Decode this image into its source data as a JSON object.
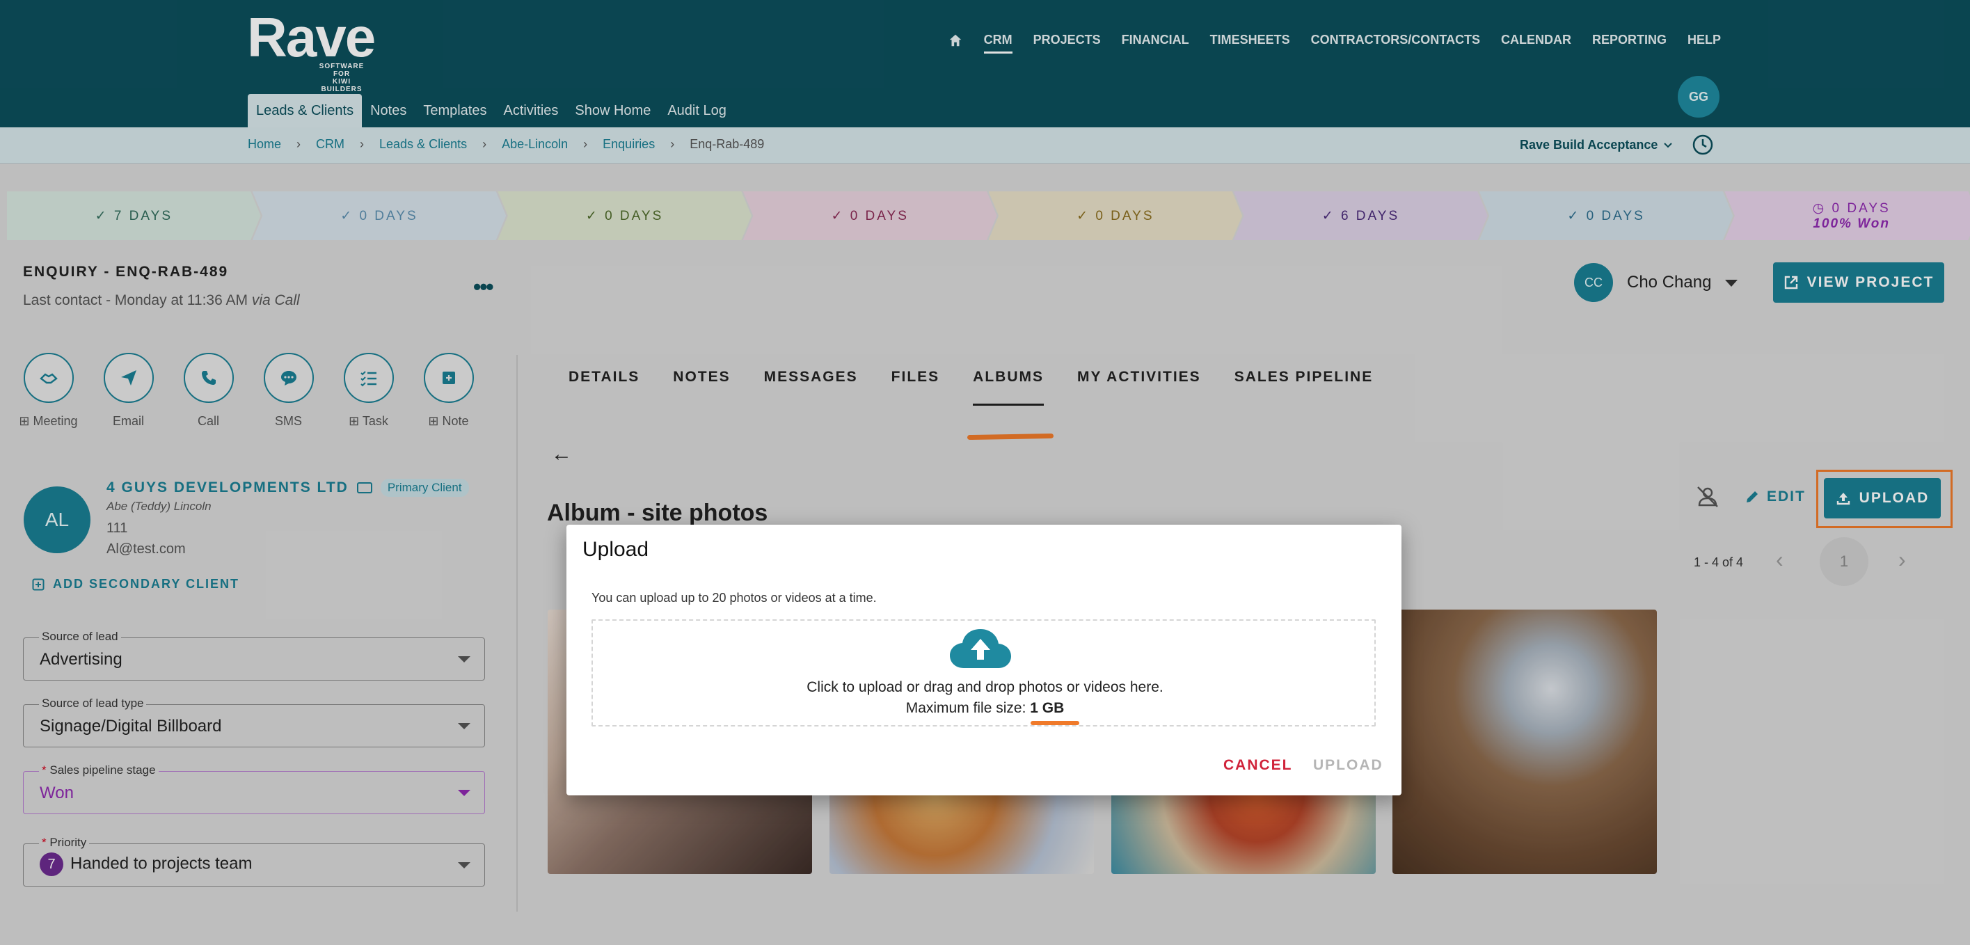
{
  "header": {
    "logo_text": "Rave",
    "logo_tagline_1": "SOFTWARE FOR",
    "logo_tagline_2": "KIWI BUILDERS",
    "nav": [
      "CRM",
      "PROJECTS",
      "FINANCIAL",
      "TIMESHEETS",
      "CONTRACTORS/CONTACTS",
      "CALENDAR",
      "REPORTING",
      "HELP"
    ],
    "user_initials": "GG",
    "subnav": [
      "Leads & Clients",
      "Notes",
      "Templates",
      "Activities",
      "Show Home",
      "Audit Log"
    ]
  },
  "breadcrumb": {
    "items": [
      "Home",
      "CRM",
      "Leads & Clients",
      "Abe-Lincoln",
      "Enquiries"
    ],
    "current": "Enq-Rab-489",
    "separator": "›",
    "environment": "Rave Build Acceptance"
  },
  "stages": [
    {
      "label": "7 DAYS",
      "bg": "#d7e6df",
      "fg": "#2f6b5a",
      "prefix": "✓"
    },
    {
      "label": "0 DAYS",
      "bg": "#d6e2ea",
      "fg": "#5c8fb0",
      "prefix": "✓"
    },
    {
      "label": "0 DAYS",
      "bg": "#dde5d0",
      "fg": "#4e6a2a",
      "prefix": "✓"
    },
    {
      "label": "0 DAYS",
      "bg": "#e9d3de",
      "fg": "#8b2a55",
      "prefix": "✓"
    },
    {
      "label": "0 DAYS",
      "bg": "#e8e0c8",
      "fg": "#8a6d1d",
      "prefix": "✓"
    },
    {
      "label": "6 DAYS",
      "bg": "#ddd2e6",
      "fg": "#4b2a7a",
      "prefix": "✓"
    },
    {
      "label": "0 DAYS",
      "bg": "#d2e0e8",
      "fg": "#2f6f8f",
      "prefix": "✓"
    },
    {
      "label": "0 DAYS",
      "bg": "#e6d2e9",
      "fg": "#8f2ab0",
      "prefix": "◷",
      "sub": "100% Won"
    }
  ],
  "enquiry": {
    "title": "ENQUIRY - ENQ-RAB-489",
    "last_contact": "Last contact - Monday at 11:36 AM",
    "via": "via Call"
  },
  "quick_actions": [
    {
      "label": "Meeting",
      "prefix": "⊞"
    },
    {
      "label": "Email",
      "prefix": ""
    },
    {
      "label": "Call",
      "prefix": ""
    },
    {
      "label": "SMS",
      "prefix": ""
    },
    {
      "label": "Task",
      "prefix": "⊞"
    },
    {
      "label": "Note",
      "prefix": "⊞"
    }
  ],
  "client": {
    "initials": "AL",
    "company": "4 GUYS DEVELOPMENTS LTD",
    "badge": "Primary Client",
    "contact": "Abe (Teddy) Lincoln",
    "phone": "111",
    "email": "Al@test.com",
    "add_secondary": "ADD SECONDARY CLIENT"
  },
  "fields": {
    "source_label": "Source of lead",
    "source_value": "Advertising",
    "source_type_label": "Source of lead type",
    "source_type_value": "Signage/Digital Billboard",
    "pipeline_label": "Sales pipeline stage",
    "pipeline_value": "Won",
    "pipeline_color": "#8f2ab0",
    "priority_label": "Priority",
    "priority_num": "7",
    "priority_value": "Handed to projects team"
  },
  "assignee": {
    "initials": "CC",
    "name": "Cho Chang"
  },
  "view_project_label": "VIEW PROJECT",
  "tabs": [
    {
      "label": "DETAILS",
      "active": false
    },
    {
      "label": "NOTES",
      "active": false
    },
    {
      "label": "MESSAGES",
      "active": false
    },
    {
      "label": "FILES",
      "active": false
    },
    {
      "label": "ALBUMS",
      "active": true
    },
    {
      "label": "MY ACTIVITIES",
      "active": false
    },
    {
      "label": "SALES PIPELINE",
      "active": false
    }
  ],
  "album": {
    "title": "Album - site photos",
    "edit_label": "EDIT",
    "upload_label": "UPLOAD",
    "page_range": "1 - 4 of 4",
    "page_current": "1"
  },
  "modal": {
    "title": "Upload",
    "info": "You can upload up to 20 photos or videos at a time.",
    "drop_text": "Click to upload or drag and drop photos or videos here.",
    "max_size_prefix": "Maximum file size: ",
    "max_size_value": "1 GB",
    "cancel_label": "CANCEL",
    "upload_label": "UPLOAD"
  },
  "colors": {
    "header_bg": "#0c4f5c",
    "accent": "#1a7f93",
    "highlight": "#f07a2a",
    "cancel": "#d0233a"
  }
}
